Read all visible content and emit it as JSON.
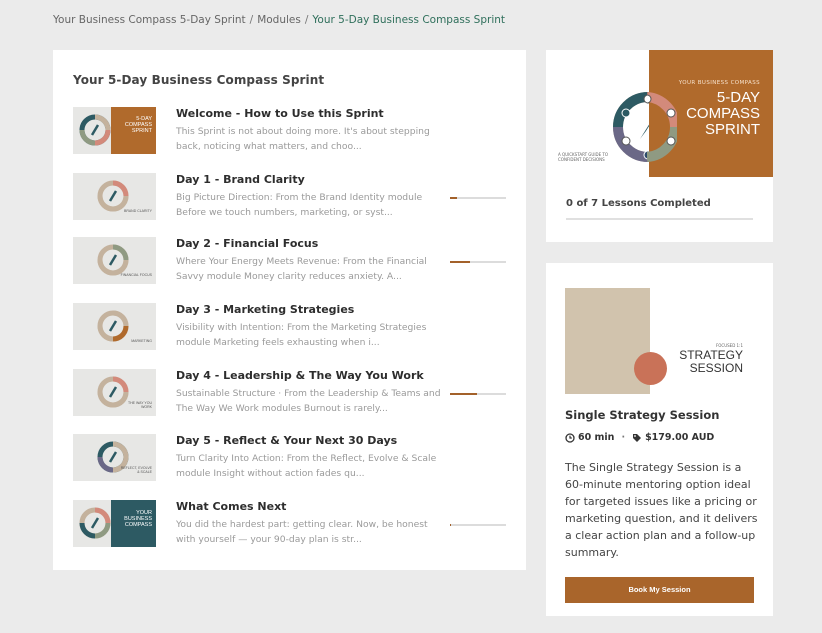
{
  "breadcrumb": {
    "items": [
      "Your Business Compass 5-Day Sprint",
      "Modules"
    ],
    "current": "Your 5-Day Business Compass Sprint"
  },
  "course": {
    "title": "Your 5-Day Business Compass Sprint",
    "lessons": [
      {
        "title": "Welcome - How to Use this Sprint",
        "description": "This Sprint is not about doing more.   It's about stepping back, noticing what matters, and choo...",
        "progress": null,
        "thumb_text": "5-DAY COMPASS SPRINT"
      },
      {
        "title": "Day 1 - Brand Clarity",
        "description": "Big Picture Direction: From the Brand Identity module Before we touch numbers, marketing, or syst...",
        "progress": 0.12,
        "thumb_text": "BRAND CLARITY"
      },
      {
        "title": "Day 2 - Financial Focus",
        "description": "Where Your Energy Meets Revenue: From the Financial Savvy module Money clarity reduces anxiety. A...",
        "progress": 0.35,
        "thumb_text": "FINANCIAL FOCUS"
      },
      {
        "title": "Day 3 - Marketing Strategies",
        "description": "Visibility with Intention: From the Marketing Strategies module Marketing feels exhausting when i...",
        "progress": null,
        "thumb_text": "MARKETING"
      },
      {
        "title": "Day 4 - Leadership & The Way You Work",
        "description": "Sustainable Structure · From the Leadership & Teams and The Way We Work modules Burnout is rarely...",
        "progress": 0.48,
        "thumb_text": "THE WAY YOU WORK"
      },
      {
        "title": "Day 5 - Reflect & Your Next 30 Days",
        "description": "Turn Clarity Into Action: From the Reflect, Evolve & Scale module Insight without action fades qu...",
        "progress": null,
        "thumb_text": "REFLECT, EVOLVE & SCALE"
      },
      {
        "title": "What Comes Next",
        "description": "You did the hardest part: getting clear.   Now, be honest with yourself — your 90-day plan is str...",
        "progress": 0.02,
        "thumb_text": "YOUR BUSINESS COMPASS"
      }
    ]
  },
  "cover": {
    "small": "YOUR BUSINESS COMPASS",
    "big": "5-DAY COMPASS SPRINT",
    "tag": "A QUICKSTART GUIDE TO CONFIDENT DECISIONS"
  },
  "completion": {
    "text": "0 of 7 Lessons Completed",
    "fraction": 0
  },
  "session": {
    "focused": "FOCUSED 1:1",
    "image_title": "STRATEGY SESSION",
    "title": "Single Strategy Session",
    "duration": "60 min",
    "price": "$179.00 AUD",
    "description": "The Single Strategy Session is a 60-minute mentoring option ideal for targeted issues like a pricing or marketing question, and it delivers a clear action plan and a follow-up summary.",
    "button": "Book My Session"
  },
  "colors": {
    "accent": "#a9652b",
    "breadcrumb_current": "#2f6f5b",
    "beige": "#d1c3ad",
    "coral": "#c97258",
    "teal": "#2d5a63"
  }
}
